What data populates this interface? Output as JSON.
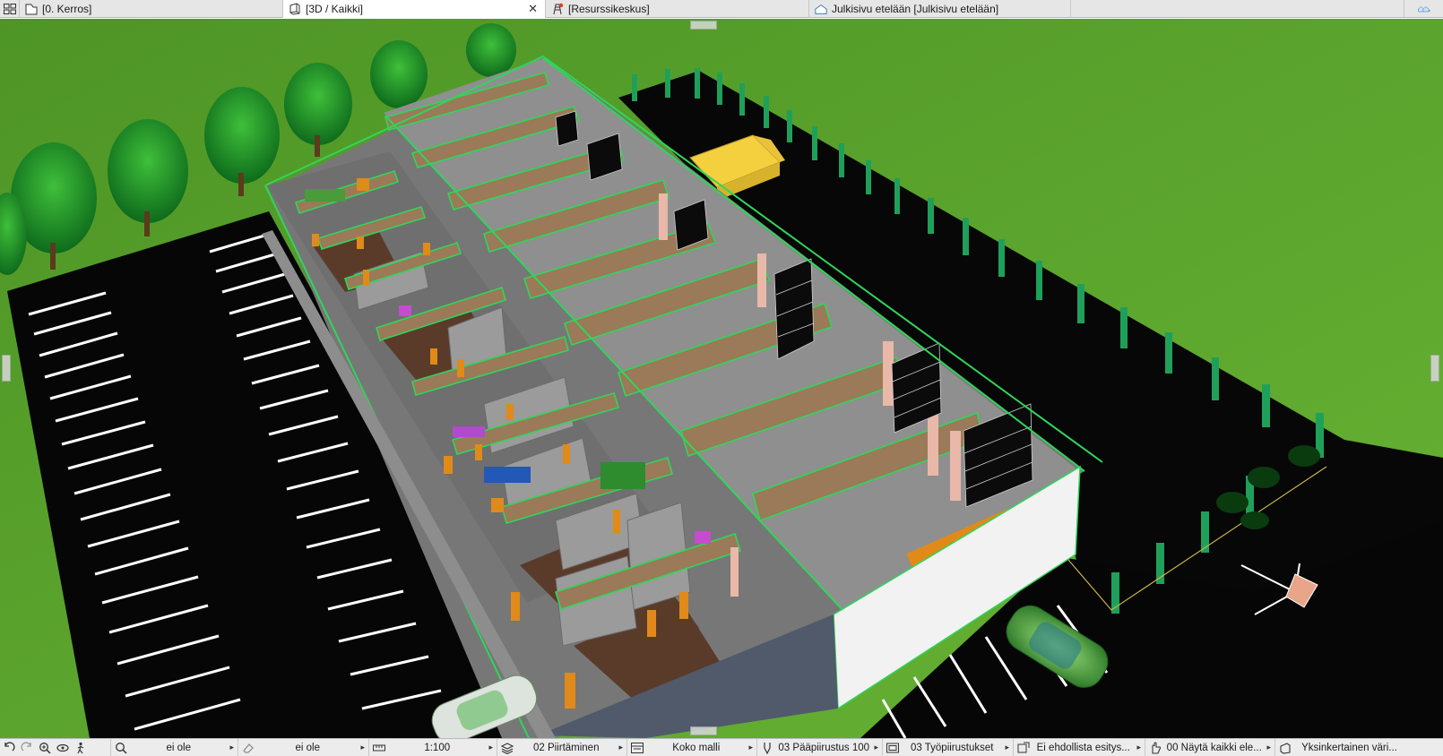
{
  "tabs": [
    {
      "label": "[0. Kerros]",
      "icon": "floor-plan-icon",
      "active": false
    },
    {
      "label": "[3D / Kaikki]",
      "icon": "3d-view-icon",
      "active": true,
      "closable": true
    },
    {
      "label": "[Resurssikeskus]",
      "icon": "resource-center-icon",
      "active": false
    },
    {
      "label": "Julkisivu etelään [Julkisivu etelään]",
      "icon": "elevation-icon",
      "active": false
    }
  ],
  "tab_close_glyph": "✕",
  "status_bar": {
    "layer_combo_1": "ei ole",
    "layer_combo_2": "ei ole",
    "scale": "1:100",
    "pen_set": "02 Piirtäminen",
    "model_view": "Koko malli",
    "dimension_std": "03 Pääpiirustus 100",
    "layer_set": "03 Työpiirustukset",
    "renovation": "Ei ehdollista esitys...",
    "element_filter": "00 Näytä kaikki ele...",
    "graphic_override": "Yksinkertainen väri..."
  },
  "colors": {
    "grass": "#5aa02c",
    "asphalt": "#0a0a0a",
    "parking_lines": "#ffffff",
    "selection_green": "#2fd65a",
    "wall_white": "#f2f2f2",
    "floor_gray": "#8a8a8a",
    "beam_wood": "#9a7a58",
    "door_orange": "#e08a1a",
    "truck_yellow": "#f4d03f"
  }
}
